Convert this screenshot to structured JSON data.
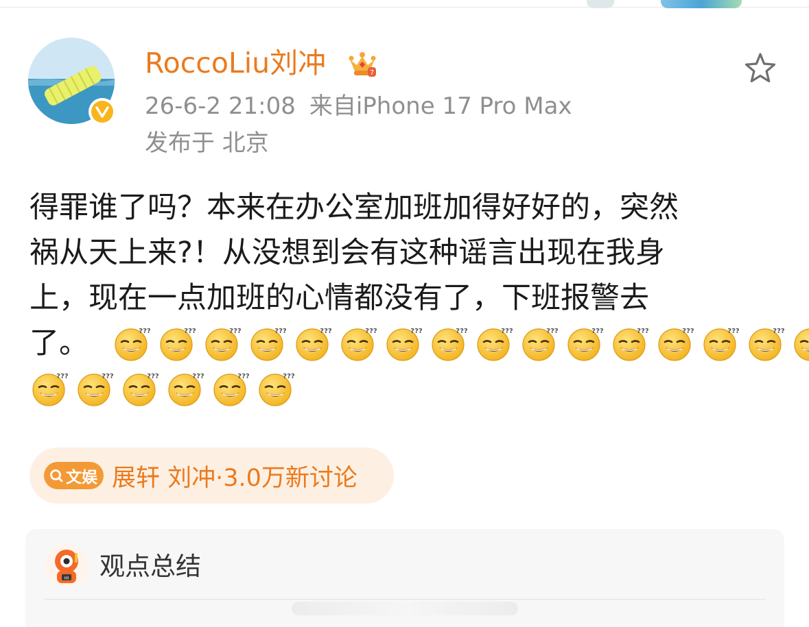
{
  "post": {
    "author": {
      "name": "RoccoLiu刘冲",
      "verified": true,
      "badge_icon": "crown-icon"
    },
    "timestamp": "26-6-2 21:08",
    "source": "来自iPhone 17 Pro Max",
    "location": "发布于 北京",
    "text_lines": [
      "得罪谁了吗？本来在办公室加班加得好好的，突然",
      "祸从天上来?！从没想到会有这种谣言出现在我身",
      "上，现在一点加班的心情都没有了，下班报警去",
      "了。"
    ],
    "emoji_name": "doge-sweat-emoji",
    "emoji_count": 22
  },
  "topic": {
    "tag": "文娱",
    "name": "展轩 刘冲",
    "count": "·3.0万新讨论"
  },
  "summary": {
    "title": "观点总结"
  },
  "colors": {
    "accent": "#eb7a1d",
    "meta_gray": "#8f8f8f",
    "tag_orange": "#f39a36",
    "pill_bg": "#fdf0e3",
    "card_bg": "#f7f7f7"
  }
}
